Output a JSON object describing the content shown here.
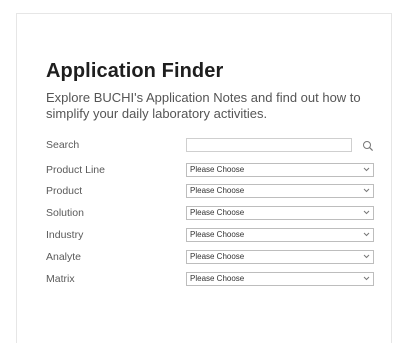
{
  "header": {
    "title": "Application Finder",
    "subtitle": "Explore BUCHI's Application Notes and find out how to simplify your daily laboratory activities."
  },
  "search": {
    "label": "Search",
    "value": "",
    "icon": "search-icon"
  },
  "filters": [
    {
      "label": "Product Line",
      "selected": "Please Choose"
    },
    {
      "label": "Product",
      "selected": "Please Choose"
    },
    {
      "label": "Solution",
      "selected": "Please Choose"
    },
    {
      "label": "Industry",
      "selected": "Please Choose"
    },
    {
      "label": "Analyte",
      "selected": "Please Choose"
    },
    {
      "label": "Matrix",
      "selected": "Please Choose"
    }
  ],
  "colors": {
    "title": "#1e1e1e",
    "text": "#555555",
    "border": "#bdbdbd"
  }
}
